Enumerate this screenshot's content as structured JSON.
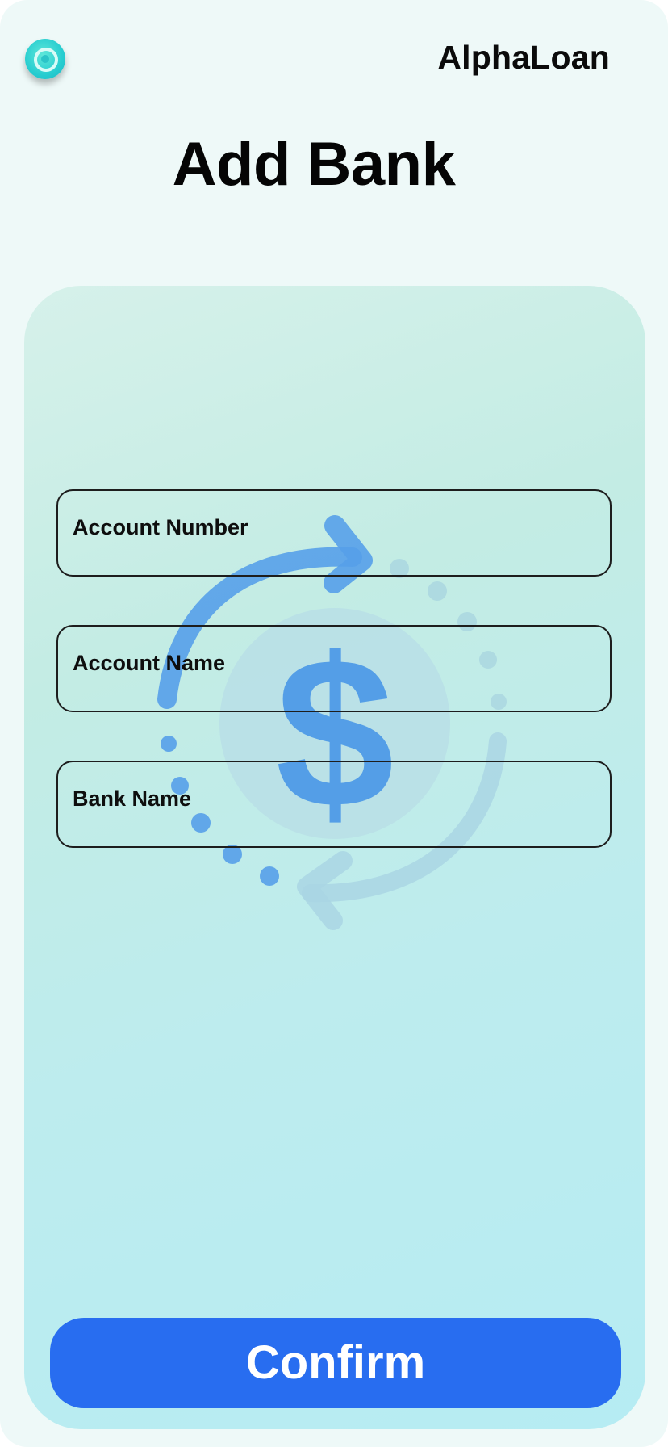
{
  "header": {
    "logo_icon": "target-logo-icon",
    "brand": "AlphaLoan"
  },
  "page": {
    "title": "Add Bank"
  },
  "form": {
    "fields": [
      {
        "label": "Account Number",
        "value": ""
      },
      {
        "label": "Account Name",
        "value": ""
      },
      {
        "label": "Bank Name",
        "value": ""
      }
    ],
    "confirm_label": "Confirm"
  },
  "illustration": {
    "icon": "dollar-exchange-cycle-icon",
    "colors": {
      "primary": "#4f9be8",
      "faded": "#b7dde6"
    }
  },
  "colors": {
    "background": "#eef9f8",
    "accent": "#286df0",
    "logo": "#27cdd0"
  }
}
